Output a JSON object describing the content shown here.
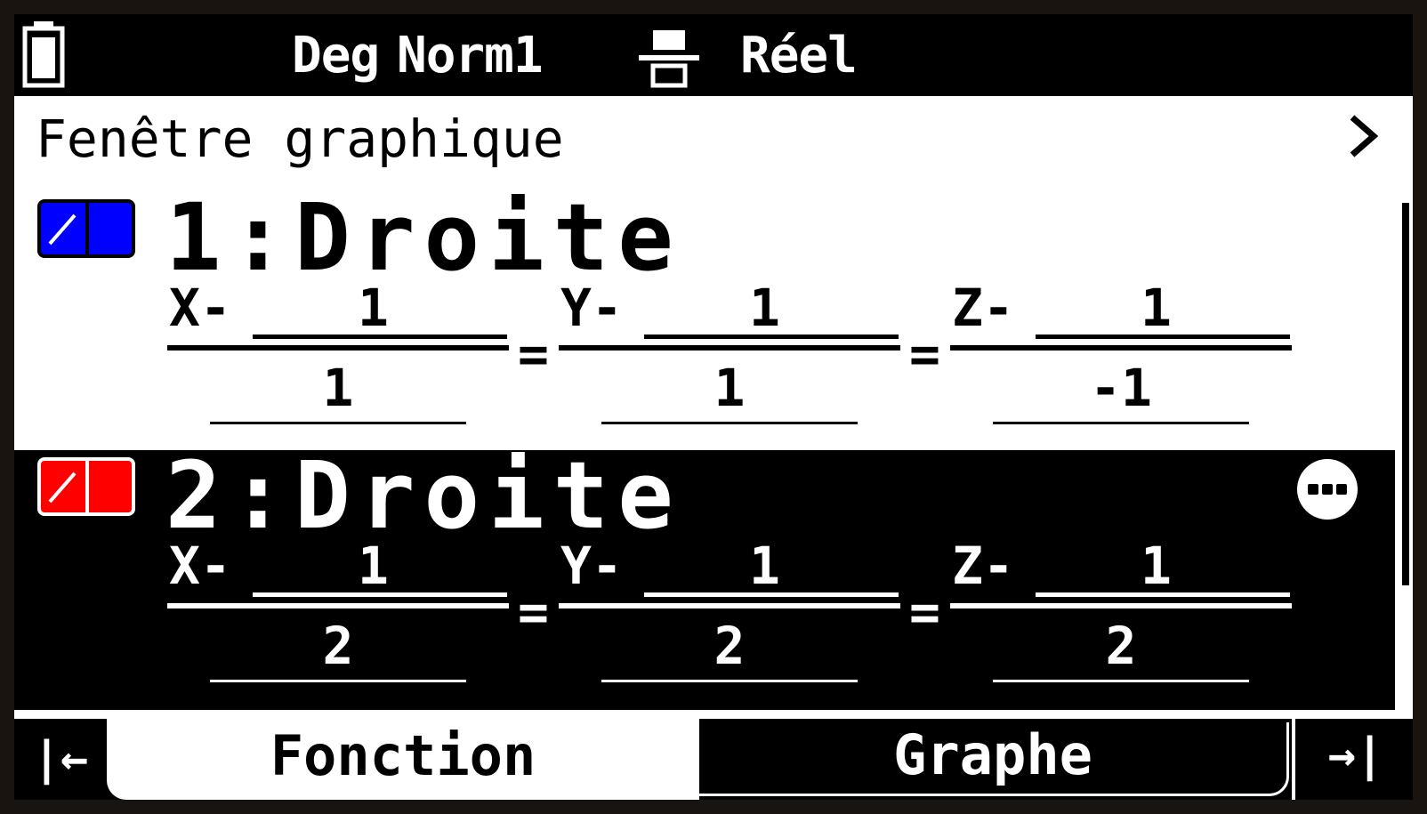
{
  "status_bar": {
    "angle": "Deg",
    "display": "Norm1",
    "complex_mode": "Réel",
    "battery_icon": "battery-icon",
    "format_icon": "display-format-icon"
  },
  "panel": {
    "title": "Fenêtre graphique",
    "chevron_icon": "chevron-right-icon"
  },
  "equations": [
    {
      "label": "1:Droite",
      "color": "#0000ff",
      "x_num_var": "X-",
      "x_num_val": "1",
      "x_den": "1",
      "y_num_var": "Y-",
      "y_num_val": "1",
      "y_den": "1",
      "z_num_var": "Z-",
      "z_num_val": "1",
      "z_den": "-1",
      "eq1": "=",
      "eq2": "="
    },
    {
      "label": "2:Droite",
      "color": "#ff0000",
      "selected": true,
      "x_num_var": "X-",
      "x_num_val": "1",
      "x_den": "2",
      "y_num_var": "Y-",
      "y_num_val": "1",
      "y_den": "2",
      "z_num_var": "Z-",
      "z_num_val": "1",
      "z_den": "2",
      "eq1": "=",
      "eq2": "=",
      "more_icon": "more-options-icon"
    }
  ],
  "tabs": {
    "left_arrow": "|←",
    "fonction": "Fonction",
    "graphe": "Graphe",
    "right_arrow": "→|"
  }
}
